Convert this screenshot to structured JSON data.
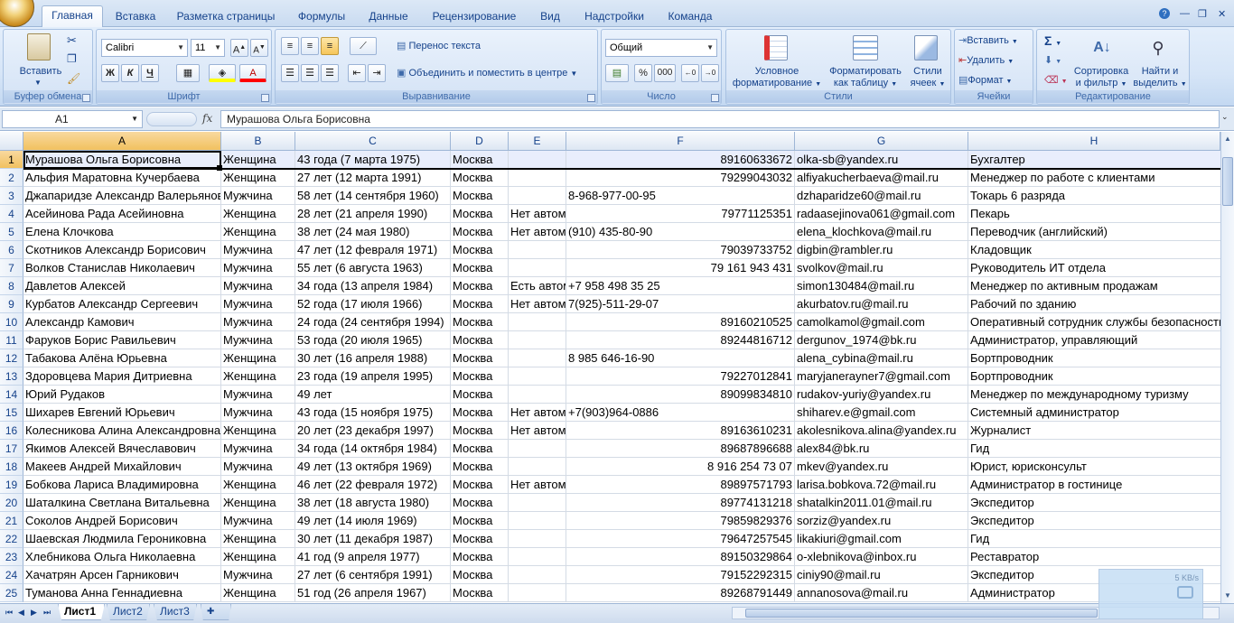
{
  "tabs": [
    "Главная",
    "Вставка",
    "Разметка страницы",
    "Формулы",
    "Данные",
    "Рецензирование",
    "Вид",
    "Надстройки",
    "Команда"
  ],
  "ribbon": {
    "clipboard": {
      "label": "Буфер обмена",
      "paste": "Вставить"
    },
    "font": {
      "label": "Шрифт",
      "name": "Calibri",
      "size": "11",
      "bold": "Ж",
      "italic": "К",
      "underline": "Ч"
    },
    "alignment": {
      "label": "Выравнивание",
      "wrap": "Перенос текста",
      "merge": "Объединить и поместить в центре"
    },
    "number": {
      "label": "Число",
      "format": "Общий",
      "percent": "%",
      "thousands": "000"
    },
    "styles": {
      "label": "Стили",
      "conditional_1": "Условное",
      "conditional_2": "форматирование",
      "table_1": "Форматировать",
      "table_2": "как таблицу",
      "cell_1": "Стили",
      "cell_2": "ячеек"
    },
    "cells": {
      "label": "Ячейки",
      "insert": "Вставить",
      "delete": "Удалить",
      "format": "Формат"
    },
    "editing": {
      "label": "Редактирование",
      "sigma": "Σ",
      "sort_1": "Сортировка",
      "sort_2": "и фильтр",
      "find_1": "Найти и",
      "find_2": "выделить"
    }
  },
  "formula_bar": {
    "name_box": "A1",
    "fx": "fx",
    "content": "Мурашова Ольга Борисовна"
  },
  "columns": [
    "A",
    "B",
    "C",
    "D",
    "E",
    "F",
    "G",
    "H"
  ],
  "rows": [
    {
      "n": "1",
      "a": "Мурашова Ольга Борисовна",
      "b": "Женщина",
      "c": "43  года (7 марта 1975)",
      "d": "Москва",
      "e": "",
      "f": "89160633672",
      "g": "olka-sb@yandex.ru",
      "h": "Бухгалтер"
    },
    {
      "n": "2",
      "a": "Альфия Маратовна Кучербаева",
      "b": "Женщина",
      "c": "27  лет (12 марта 1991)",
      "d": "Москва",
      "e": "",
      "f": "79299043032",
      "g": "alfiyakucherbaeva@mail.ru",
      "h": "Менеджер по работе с клиентами"
    },
    {
      "n": "3",
      "a": "Джапаридзе Александр Валерьянович",
      "b": "Мужчина",
      "c": "58  лет (14 сентября 1960)",
      "d": "Москва",
      "e": "",
      "f": "8-968-977-00-95",
      "g": "dzhaparidze60@mail.ru",
      "h": "Токарь 6 разряда"
    },
    {
      "n": "4",
      "a": "Асейинова Рада Асейиновна",
      "b": "Женщина",
      "c": "28  лет (21 апреля 1990)",
      "d": "Москва",
      "e": "Нет автомобиля",
      "f": "79771125351",
      "g": "radaasejinova061@gmail.com",
      "h": "Пекарь"
    },
    {
      "n": "5",
      "a": "Елена Клочкова",
      "b": "Женщина",
      "c": "38  лет (24 мая 1980)",
      "d": "Москва",
      "e": "Нет автомобиля",
      "f": "(910) 435-80-90",
      "g": "elena_klochkova@mail.ru",
      "h": "Переводчик (английский)"
    },
    {
      "n": "6",
      "a": "Скотников Александр Борисович",
      "b": "Мужчина",
      "c": "47  лет (12 февраля 1971)",
      "d": "Москва",
      "e": "",
      "f": "79039733752",
      "g": "digbin@rambler.ru",
      "h": "Кладовщик"
    },
    {
      "n": "7",
      "a": "Волков Станислав Николаевич",
      "b": "Мужчина",
      "c": "55  лет (6 августа 1963)",
      "d": "Москва",
      "e": "",
      "f": "79 161 943 431",
      "g": "svolkov@mail.ru",
      "h": "Руководитель ИТ отдела"
    },
    {
      "n": "8",
      "a": "Давлетов Алексей",
      "b": "Мужчина",
      "c": "34  года (13 апреля 1984)",
      "d": "Москва",
      "e": "Есть автомобиль",
      "f": "+7 958 498 35 25",
      "g": "simon130484@mail.ru",
      "h": "Менеджер по активным продажам"
    },
    {
      "n": "9",
      "a": "Курбатов Александр Сергеевич",
      "b": "Мужчина",
      "c": "52  года (17 июля 1966)",
      "d": "Москва",
      "e": "Нет автомобиля",
      "f": "7(925)-511-29-07",
      "g": "akurbatov.ru@mail.ru",
      "h": "Рабочий по зданию"
    },
    {
      "n": "10",
      "a": "Александр Камович",
      "b": "Мужчина",
      "c": "24  года (24 сентября 1994)",
      "d": "Москва",
      "e": "",
      "f": "89160210525",
      "g": "camolkamol@gmail.com",
      "h": "Оперативный сотрудник службы безопасности"
    },
    {
      "n": "11",
      "a": "Фаруков Борис Равильевич",
      "b": "Мужчина",
      "c": "53  года (20 июля 1965)",
      "d": "Москва",
      "e": "",
      "f": "89244816712",
      "g": "dergunov_1974@bk.ru",
      "h": "Администратор, управляющий"
    },
    {
      "n": "12",
      "a": "Табакова Алёна Юрьевна",
      "b": "Женщина",
      "c": "30  лет (16 апреля 1988)",
      "d": "Москва",
      "e": "",
      "f": "8 985 646-16-90",
      "g": "alena_cybina@mail.ru",
      "h": "Бортпроводник"
    },
    {
      "n": "13",
      "a": "Здоровцева Мария Дитриевна",
      "b": "Женщина",
      "c": "23  года (19 апреля 1995)",
      "d": "Москва",
      "e": "",
      "f": "79227012841",
      "g": "maryjanerayner7@gmail.com",
      "h": "Бортпроводник"
    },
    {
      "n": "14",
      "a": "Юрий Рудаков",
      "b": "Мужчина",
      "c": "49 лет",
      "d": "Москва",
      "e": "",
      "f": "89099834810",
      "g": "rudakov-yuriy@yandex.ru",
      "h": "Менеджер по международному туризму"
    },
    {
      "n": "15",
      "a": "Шихарев Евгений Юрьевич",
      "b": "Мужчина",
      "c": "43  года (15 ноября 1975)",
      "d": "Москва",
      "e": "Нет автомобиля",
      "f": "+7(903)964-0886",
      "g": "shiharev.e@gmail.com",
      "h": "Системный администратор"
    },
    {
      "n": "16",
      "a": "Колесникова Алина Александровна",
      "b": "Женщина",
      "c": "20  лет (23 декабря 1997)",
      "d": "Москва",
      "e": "Нет автомобиля",
      "f": "89163610231",
      "g": "akolesnikova.alina@yandex.ru",
      "h": "Журналист"
    },
    {
      "n": "17",
      "a": "Якимов Алексей Вячеславович",
      "b": "Мужчина",
      "c": "34  года (14 октября 1984)",
      "d": "Москва",
      "e": "",
      "f": "89687896688",
      "g": "alex84@bk.ru",
      "h": "Гид"
    },
    {
      "n": "18",
      "a": "Макеев Андрей Михайлович",
      "b": "Мужчина",
      "c": "49  лет (13 октября 1969)",
      "d": "Москва",
      "e": "",
      "f": "8 916 254 73 07",
      "g": "mkev@yandex.ru",
      "h": "Юрист, юрисконсульт"
    },
    {
      "n": "19",
      "a": "Бобкова Лариса Владимировна",
      "b": "Женщина",
      "c": "46  лет (22 февраля 1972)",
      "d": "Москва",
      "e": "Нет автомобиля",
      "f": "89897571793",
      "g": "larisa.bobkova.72@mail.ru",
      "h": "Администратор в гостинице"
    },
    {
      "n": "20",
      "a": "Шаталкина Светлана Витальевна",
      "b": "Женщина",
      "c": "38  лет (18 августа 1980)",
      "d": "Москва",
      "e": "",
      "f": "89774131218",
      "g": "shatalkin2011.01@mail.ru",
      "h": "Экспедитор"
    },
    {
      "n": "21",
      "a": "Соколов Андрей Борисович",
      "b": "Мужчина",
      "c": "49  лет (14 июля 1969)",
      "d": "Москва",
      "e": "",
      "f": "79859829376",
      "g": "sorziz@yandex.ru",
      "h": "Экспедитор"
    },
    {
      "n": "22",
      "a": "Шаевская Людмила Героникoвна",
      "b": "Женщина",
      "c": "30  лет (11 декабря 1987)",
      "d": "Москва",
      "e": "",
      "f": "79647257545",
      "g": "likakiuri@gmail.com",
      "h": "Гид"
    },
    {
      "n": "23",
      "a": "Хлебникова Ольга Николаевна",
      "b": "Женщина",
      "c": "41  год (9 апреля 1977)",
      "d": "Москва",
      "e": "",
      "f": "89150329864",
      "g": "o-xlebnikova@inbox.ru",
      "h": "Реставратор"
    },
    {
      "n": "24",
      "a": "Хачатрян Арсен Гарникович",
      "b": "Мужчина",
      "c": "27  лет (6 сентября 1991)",
      "d": "Москва",
      "e": "",
      "f": "79152292315",
      "g": "ciniy90@mail.ru",
      "h": "Экспедитор"
    },
    {
      "n": "25",
      "a": "Туманова Анна Геннадиевна",
      "b": "Женщина",
      "c": "51  год (26 апреля 1967)",
      "d": "Москва",
      "e": "",
      "f": "89268791449",
      "g": "annanosova@mail.ru",
      "h": "Администратор"
    }
  ],
  "sheets": [
    "Лист1",
    "Лист2",
    "Лист3"
  ],
  "network_widget": {
    "speed": "5 KB/s"
  },
  "colors": {
    "accent": "#15428b",
    "header_selected": "#f1c15f",
    "ribbon": "#d6e5f7"
  }
}
